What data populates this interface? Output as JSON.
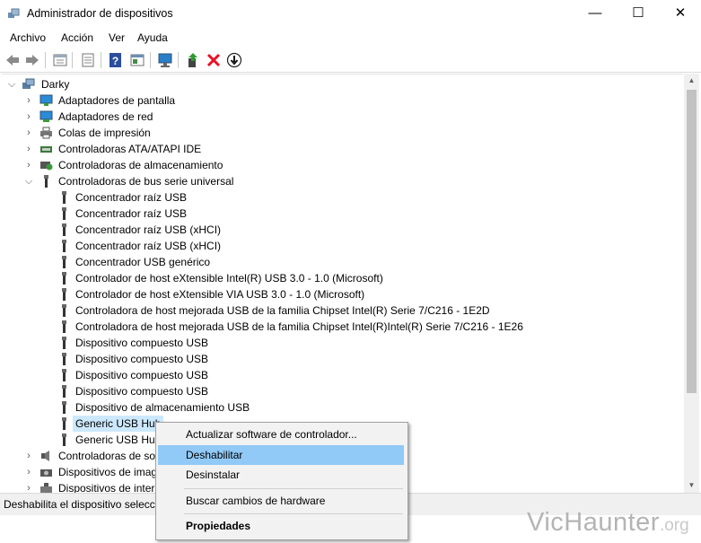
{
  "window": {
    "title": "Administrador de dispositivos",
    "minimize": "—",
    "maximize": "☐",
    "close": "✕"
  },
  "menu": [
    "Archivo",
    "Acción",
    "Ver",
    "Ayuda"
  ],
  "toolbar_icons": [
    "back-arrow-icon",
    "forward-arrow-icon",
    "properties-icon",
    "details-icon",
    "help-icon",
    "view-icon",
    "monitor-scan-icon",
    "update-driver-icon",
    "uninstall-x-icon",
    "disable-down-icon"
  ],
  "tree": {
    "root": "Darky",
    "categories_top": [
      {
        "label": "Adaptadores de pantalla",
        "icon": "display-adapter-icon"
      },
      {
        "label": "Adaptadores de red",
        "icon": "network-adapter-icon"
      },
      {
        "label": "Colas de impresión",
        "icon": "print-queue-icon"
      },
      {
        "label": "Controladoras ATA/ATAPI IDE",
        "icon": "ide-controller-icon"
      },
      {
        "label": "Controladoras de almacenamiento",
        "icon": "storage-controller-icon"
      }
    ],
    "usb_category": "Controladoras de bus serie universal",
    "usb_children": [
      "Concentrador raíz USB",
      "Concentrador raíz USB",
      "Concentrador raíz USB (xHCI)",
      "Concentrador raíz USB (xHCI)",
      "Concentrador USB genérico",
      "Controlador de host eXtensible Intel(R) USB 3.0 - 1.0 (Microsoft)",
      "Controlador de host eXtensible VIA USB 3.0 - 1.0 (Microsoft)",
      "Controladora de host mejorada USB de la familia Chipset Intel(R) Serie 7/C216 - 1E2D",
      "Controladora de host mejorada USB de la familia Chipset Intel(R)Intel(R) Serie 7/C216 - 1E26",
      "Dispositivo compuesto USB",
      "Dispositivo compuesto USB",
      "Dispositivo compuesto USB",
      "Dispositivo compuesto USB",
      "Dispositivo de almacenamiento USB",
      "Generic USB Hub",
      "Generic USB Hub"
    ],
    "categories_bottom": [
      "Controladoras de so",
      "Dispositivos de imag",
      "Dispositivos de inter"
    ]
  },
  "context_menu": {
    "items": [
      "Actualizar software de controlador...",
      "Deshabilitar",
      "Desinstalar",
      "Buscar cambios de hardware",
      "Propiedades"
    ],
    "highlighted": "Deshabilitar"
  },
  "status": "Deshabilita el dispositivo selecci",
  "watermark": {
    "main": "VicHaunter",
    "tld": ".org"
  },
  "colors": {
    "selection": "#cce8ff",
    "menu_highlight": "#91c9f7",
    "error_red": "#e81123"
  }
}
